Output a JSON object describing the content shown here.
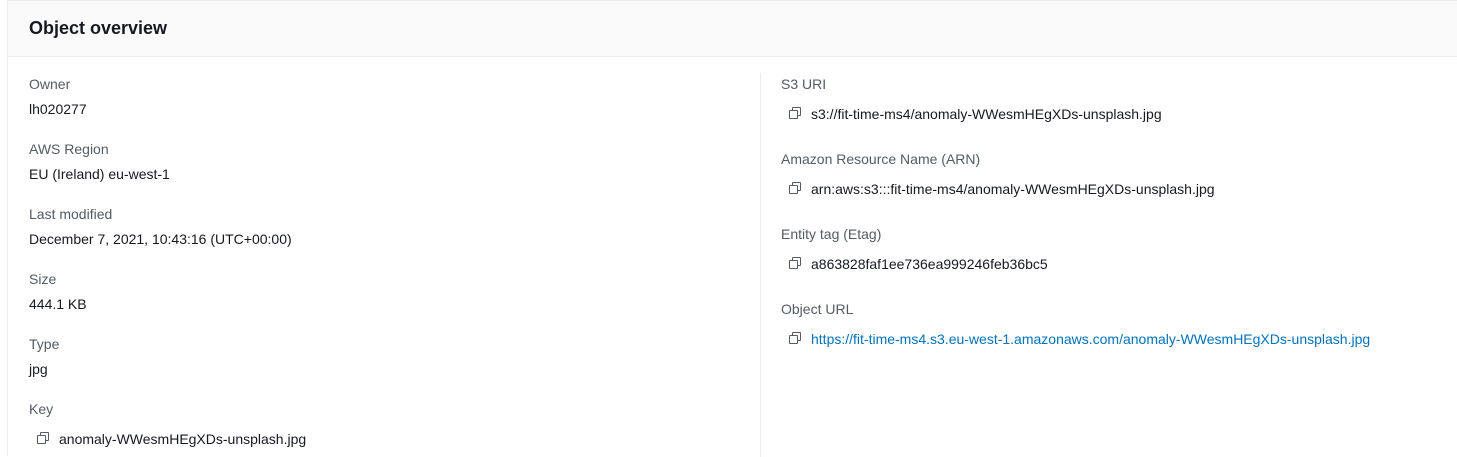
{
  "panel": {
    "title": "Object overview"
  },
  "left": {
    "owner": {
      "label": "Owner",
      "value": "lh020277"
    },
    "region": {
      "label": "AWS Region",
      "value": "EU (Ireland) eu-west-1"
    },
    "modified": {
      "label": "Last modified",
      "value": "December 7, 2021, 10:43:16 (UTC+00:00)"
    },
    "size": {
      "label": "Size",
      "value": "444.1 KB"
    },
    "type": {
      "label": "Type",
      "value": "jpg"
    },
    "key": {
      "label": "Key",
      "value": "anomaly-WWesmHEgXDs-unsplash.jpg"
    }
  },
  "right": {
    "s3uri": {
      "label": "S3 URI",
      "value": "s3://fit-time-ms4/anomaly-WWesmHEgXDs-unsplash.jpg"
    },
    "arn": {
      "label": "Amazon Resource Name (ARN)",
      "value": "arn:aws:s3:::fit-time-ms4/anomaly-WWesmHEgXDs-unsplash.jpg"
    },
    "etag": {
      "label": "Entity tag (Etag)",
      "value": "a863828faf1ee736ea999246feb36bc5"
    },
    "url": {
      "label": "Object URL",
      "value": "https://fit-time-ms4.s3.eu-west-1.amazonaws.com/anomaly-WWesmHEgXDs-unsplash.jpg"
    }
  },
  "icons": {
    "copy": "copy-icon"
  },
  "colors": {
    "label": "#545b64",
    "text": "#16191f",
    "link": "#0073bb",
    "header_bg": "#fafafa",
    "border": "#eaeded"
  }
}
